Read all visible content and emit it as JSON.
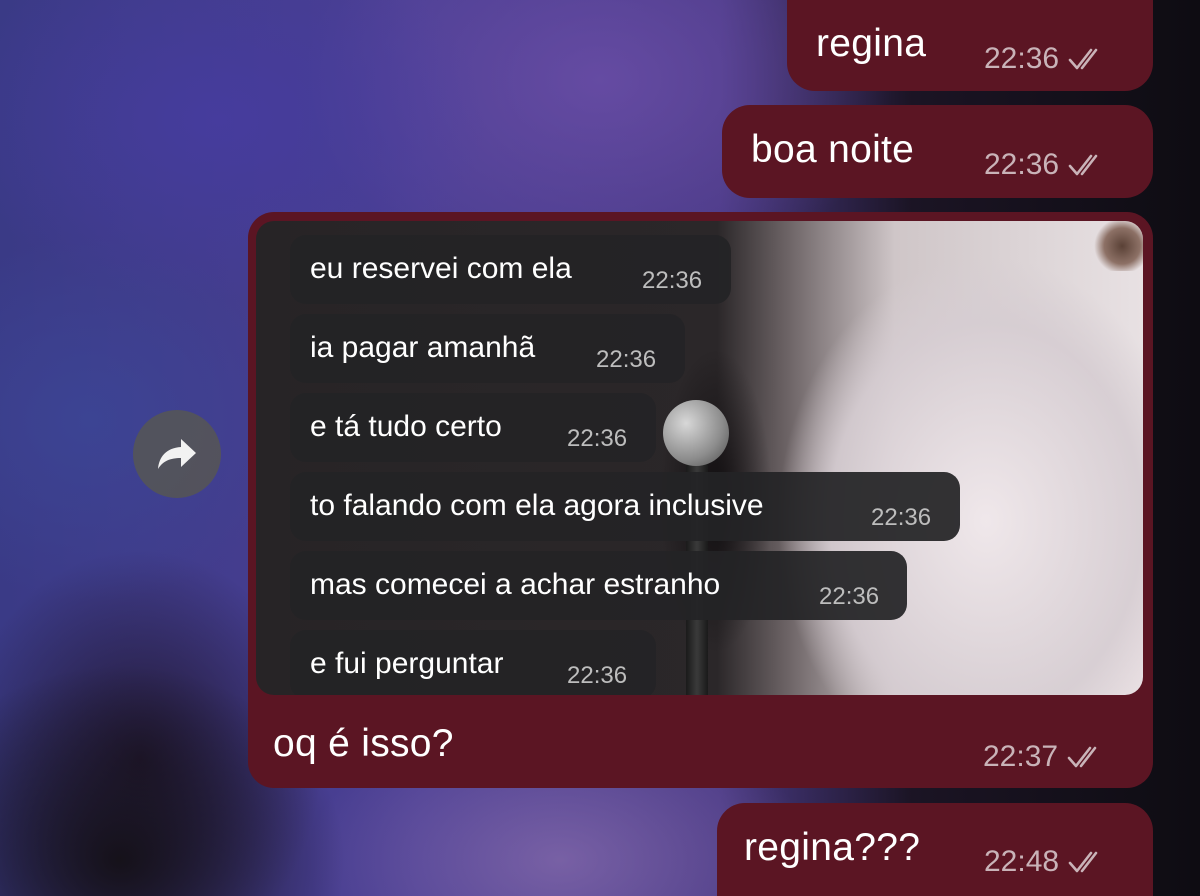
{
  "colors": {
    "outgoing_bubble": "#5b1523",
    "quoted_bubble": "#242426",
    "meta_text": "#c9b3b8",
    "forward_button": "#555555"
  },
  "messages": [
    {
      "text": "regina",
      "time": "22:36",
      "status": "read-double-check"
    },
    {
      "text": "boa noite",
      "time": "22:36",
      "status": "read-double-check"
    },
    {
      "type": "screenshot-with-caption",
      "caption": "oq é isso?",
      "time": "22:37",
      "status": "read-double-check",
      "screenshot_messages": [
        {
          "text": "eu reservei com ela",
          "time": "22:36"
        },
        {
          "text": "ia pagar amanhã",
          "time": "22:36"
        },
        {
          "text": "e tá tudo certo",
          "time": "22:36"
        },
        {
          "text": "to falando com ela agora inclusive",
          "time": "22:36"
        },
        {
          "text": "mas comecei a achar estranho",
          "time": "22:36"
        },
        {
          "text": "e fui perguntar",
          "time": "22:36"
        }
      ]
    },
    {
      "text": "regina???",
      "time": "22:48",
      "status": "read-double-check"
    }
  ],
  "forward_button": {
    "icon": "forward-arrow-icon"
  }
}
